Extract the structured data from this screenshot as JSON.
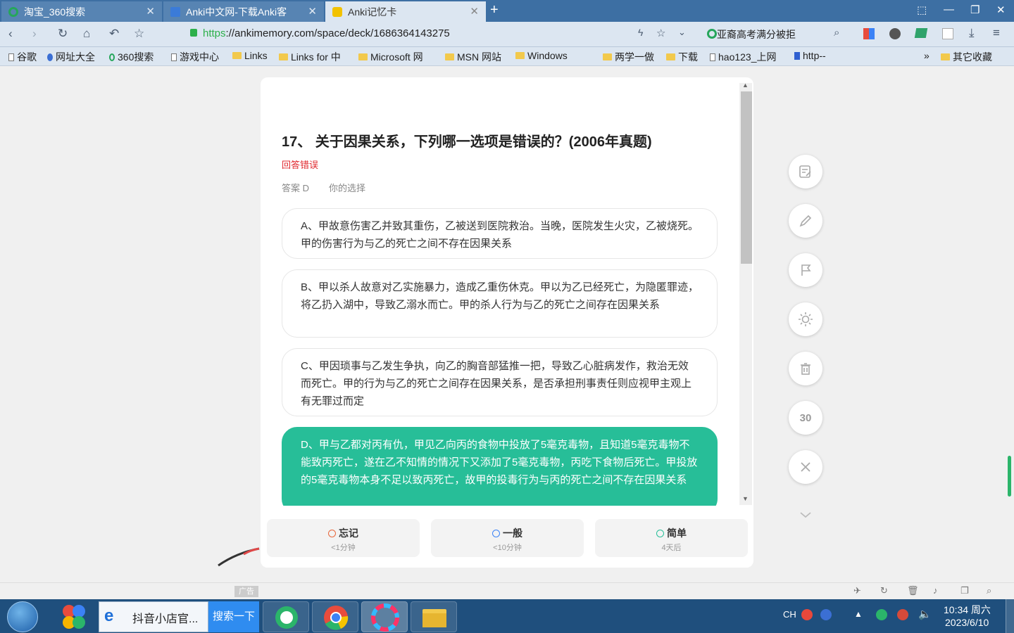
{
  "browser": {
    "tabs": [
      {
        "title": "淘宝_360搜索",
        "icon": "360-search-icon"
      },
      {
        "title": "Anki中文网-下载Anki客",
        "icon": "document-icon"
      },
      {
        "title": "Anki记忆卡",
        "icon": "anki-icon"
      }
    ],
    "url_prefix": "https",
    "url_rest": "://ankimemory.com/space/deck/1686364143275",
    "search_suggestion": "亚裔高考满分被拒"
  },
  "bookmarks": [
    {
      "label": "谷歌",
      "type": "page"
    },
    {
      "label": "网址大全",
      "type": "globe"
    },
    {
      "label": "360搜索",
      "type": "360"
    },
    {
      "label": "游戏中心",
      "type": "page"
    },
    {
      "label": "Links",
      "type": "folder"
    },
    {
      "label": "Links for 中",
      "type": "folder"
    },
    {
      "label": "Microsoft 网",
      "type": "folder"
    },
    {
      "label": "MSN 网站",
      "type": "folder"
    },
    {
      "label": "Windows",
      "type": "folder"
    },
    {
      "label": "两学一做",
      "type": "folder"
    },
    {
      "label": "下载",
      "type": "folder"
    },
    {
      "label": "hao123_上网",
      "type": "page"
    },
    {
      "label": "http--",
      "type": "baidu"
    }
  ],
  "bookmarks_more": "»",
  "bookmarks_other": "其它收藏",
  "question": {
    "title": "17、 关于因果关系，下列哪一选项是错误的？(2006年真题)",
    "status": "回答错误",
    "answer": "答案 D",
    "your_choice": "你的选择",
    "options": [
      {
        "text": "A、甲故意伤害乙并致其重伤，乙被送到医院救治。当晚，医院发生火灾，乙被烧死。甲的伤害行为与乙的死亡之间不存在因果关系",
        "selected": false
      },
      {
        "text": "B、甲以杀人故意对乙实施暴力，造成乙重伤休克。甲以为乙已经死亡，为隐匿罪迹，将乙扔入湖中，导致乙溺水而亡。甲的杀人行为与乙的死亡之间存在因果关系",
        "selected": false
      },
      {
        "text": "C、甲因琐事与乙发生争执，向乙的胸音部猛推一把，导致乙心脏病发作，救治无效而死亡。甲的行为与乙的死亡之间存在因果关系，是否承担刑事责任则应视甲主观上有无罪过而定",
        "selected": false
      },
      {
        "text": "D、甲与乙都对丙有仇，甲见乙向丙的食物中投放了5毫克毒物，且知道5毫克毒物不能致丙死亡，遂在乙不知情的情况下又添加了5毫克毒物，丙吃下食物后死亡。甲投放的5毫克毒物本身不足以致丙死亡，故甲的投毒行为与丙的死亡之间不存在因果关系",
        "selected": true
      }
    ]
  },
  "side_tools": {
    "timer": "30"
  },
  "answer_buttons": [
    {
      "label": "忘记",
      "sub": "<1分钟",
      "face": "sad"
    },
    {
      "label": "一般",
      "sub": "<10分钟",
      "face": "neutral"
    },
    {
      "label": "简单",
      "sub": "4天后",
      "face": "happy"
    }
  ],
  "status_bar": {
    "ad": "广告"
  },
  "taskbar": {
    "douyin": "抖音小店官...",
    "search_button": "搜索一下",
    "lang": "CH",
    "time": "10:34 周六",
    "date": "2023/6/10"
  },
  "colors": {
    "accent": "#27be98",
    "error": "#e0282e",
    "tabbar": "#3d6fa3"
  }
}
